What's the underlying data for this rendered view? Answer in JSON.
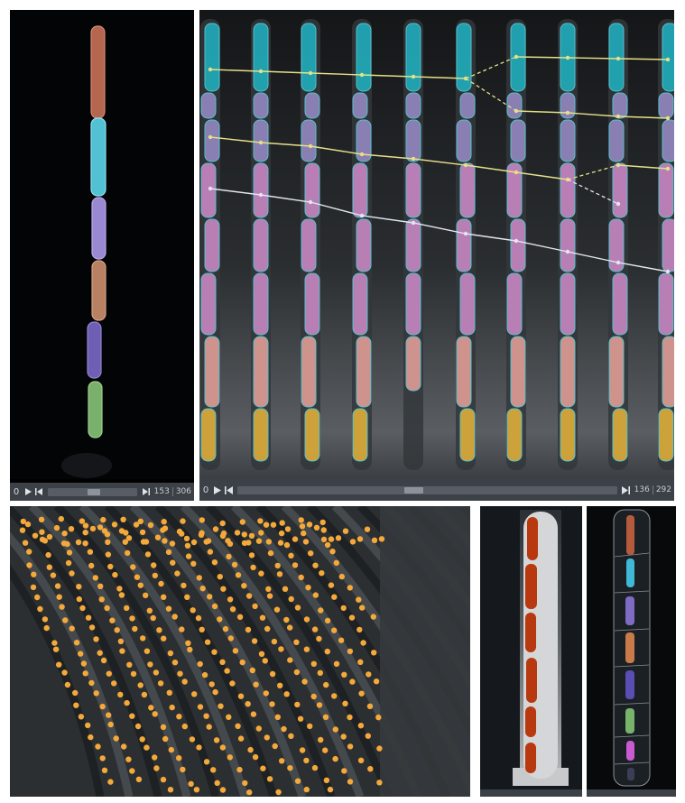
{
  "panel_a": {
    "start": "0",
    "frame": "153",
    "total": "306",
    "progress": 0.5
  },
  "panel_b": {
    "start": "0",
    "frame": "136",
    "total": "292",
    "progress": 0.466
  },
  "icons": {
    "play": "play-icon",
    "step_back": "step-back-icon",
    "step_forward": "step-forward-icon"
  },
  "colors": {
    "cell_teal": "#1fb3c4",
    "cell_lavender": "#9a8dc9",
    "cell_pink": "#d08ccb",
    "cell_salmon": "#e9a39a",
    "cell_yellow": "#e8b43a",
    "lineage_yellow": "#e6e089",
    "lineage_white": "#e2e6ee",
    "kymo_dot": "#f4a93a",
    "outline": "#5fd8e5",
    "mask_red": "#b8380f",
    "cell_orange": "#c97a4a",
    "cell_purple": "#7d6bc4",
    "cell_green": "#77b36a",
    "cell_blue": "#3fb9d6",
    "cell_magenta": "#c85ad2"
  }
}
